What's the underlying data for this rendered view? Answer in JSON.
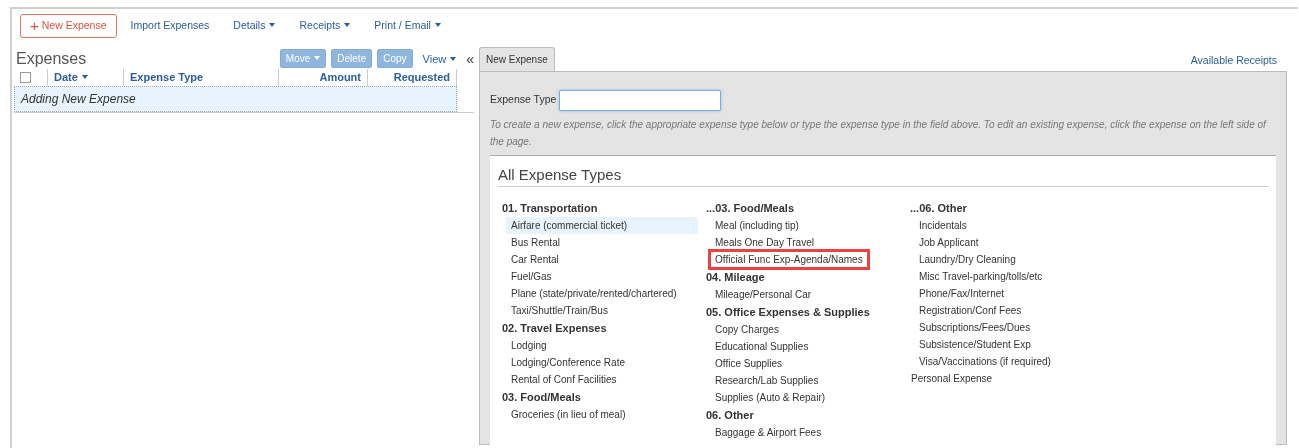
{
  "toolbar": {
    "new_button": {
      "icon": "+",
      "label": "New Expense"
    },
    "links": [
      {
        "label": "Import Expenses",
        "dropdown": false
      },
      {
        "label": "Details",
        "dropdown": true
      },
      {
        "label": "Receipts",
        "dropdown": true
      },
      {
        "label": "Print / Email",
        "dropdown": true
      }
    ]
  },
  "expenses": {
    "title": "Expenses",
    "actions": [
      {
        "label": "Move",
        "dropdown": true,
        "disabled": true
      },
      {
        "label": "Delete",
        "dropdown": false,
        "disabled": true
      },
      {
        "label": "Copy",
        "dropdown": false,
        "disabled": true
      }
    ],
    "view": {
      "label": "View",
      "dropdown": true
    },
    "collapse": "«",
    "select_all": {
      "checked": false
    },
    "columns": [
      {
        "label": "Date",
        "sorted": true
      },
      {
        "label": "Expense Type",
        "sorted": false
      },
      {
        "label": "Amount",
        "sorted": false
      },
      {
        "label": "Requested",
        "sorted": false
      }
    ],
    "rows": [
      {
        "label": "Adding New Expense",
        "selected": true
      }
    ]
  },
  "detail": {
    "tabs": [
      {
        "label": "New Expense",
        "selected": true
      }
    ],
    "available_receipts": "Available Receipts",
    "expense_type": {
      "label": "Expense Type"
    },
    "hint": "To create a new expense, click the appropriate expense type below or type the expense type in the field above. To edit an existing expense, click the expense on the left side of the page.",
    "section_title": "All Expense Types",
    "columns": [
      {
        "entries": [
          {
            "kind": "group",
            "label": "01. Transportation",
            "items": [
              {
                "label": "Airfare (commercial ticket)",
                "selected": true,
                "highlighted": false
              },
              {
                "label": "Bus Rental",
                "selected": false,
                "highlighted": false
              },
              {
                "label": "Car Rental",
                "selected": false,
                "highlighted": false
              },
              {
                "label": "Fuel/Gas",
                "selected": false,
                "highlighted": false
              },
              {
                "label": "Plane (state/private/rented/chartered)",
                "selected": false,
                "highlighted": false
              },
              {
                "label": "Taxi/Shuttle/Train/Bus",
                "selected": false,
                "highlighted": false
              }
            ]
          },
          {
            "kind": "group",
            "label": "02. Travel Expenses",
            "items": [
              {
                "label": "Lodging",
                "selected": false,
                "highlighted": false
              },
              {
                "label": "Lodging/Conference Rate",
                "selected": false,
                "highlighted": false
              },
              {
                "label": "Rental of Conf Facilities",
                "selected": false,
                "highlighted": false
              }
            ]
          },
          {
            "kind": "group",
            "label": "03. Food/Meals",
            "items": [
              {
                "label": "Groceries (in lieu of meal)",
                "selected": false,
                "highlighted": false
              }
            ]
          }
        ]
      },
      {
        "entries": [
          {
            "kind": "group",
            "label": "...03. Food/Meals",
            "items": [
              {
                "label": "Meal (including tip)",
                "selected": false,
                "highlighted": false
              },
              {
                "label": "Meals One Day Travel",
                "selected": false,
                "highlighted": false
              },
              {
                "label": "Official Func Exp-Agenda/Names",
                "selected": false,
                "highlighted": true
              }
            ]
          },
          {
            "kind": "group",
            "label": "04. Mileage",
            "items": [
              {
                "label": "Mileage/Personal Car",
                "selected": false,
                "highlighted": false
              }
            ]
          },
          {
            "kind": "group",
            "label": "05. Office Expenses & Supplies",
            "items": [
              {
                "label": "Copy Charges",
                "selected": false,
                "highlighted": false
              },
              {
                "label": "Educational Supplies",
                "selected": false,
                "highlighted": false
              },
              {
                "label": "Office Supplies",
                "selected": false,
                "highlighted": false
              },
              {
                "label": "Research/Lab Supplies",
                "selected": false,
                "highlighted": false
              },
              {
                "label": "Supplies (Auto & Repair)",
                "selected": false,
                "highlighted": false
              }
            ]
          },
          {
            "kind": "group",
            "label": "06. Other",
            "items": [
              {
                "label": "Baggage & Airport Fees",
                "selected": false,
                "highlighted": false
              }
            ]
          }
        ]
      },
      {
        "entries": [
          {
            "kind": "group",
            "label": "...06. Other",
            "items": [
              {
                "label": "Incidentals",
                "selected": false,
                "highlighted": false
              },
              {
                "label": "Job Applicant",
                "selected": false,
                "highlighted": false
              },
              {
                "label": "Laundry/Dry Cleaning",
                "selected": false,
                "highlighted": false
              },
              {
                "label": "Misc Travel-parking/tolls/etc",
                "selected": false,
                "highlighted": false
              },
              {
                "label": "Phone/Fax/Internet",
                "selected": false,
                "highlighted": false
              },
              {
                "label": "Registration/Conf Fees",
                "selected": false,
                "highlighted": false
              },
              {
                "label": "Subscriptions/Fees/Dues",
                "selected": false,
                "highlighted": false
              },
              {
                "label": "Subsistence/Student Exp",
                "selected": false,
                "highlighted": false
              },
              {
                "label": "Visa/Vaccinations (if required)",
                "selected": false,
                "highlighted": false
              }
            ]
          },
          {
            "kind": "item",
            "label": "Personal Expense",
            "selected": false,
            "highlighted": false
          }
        ]
      }
    ]
  }
}
